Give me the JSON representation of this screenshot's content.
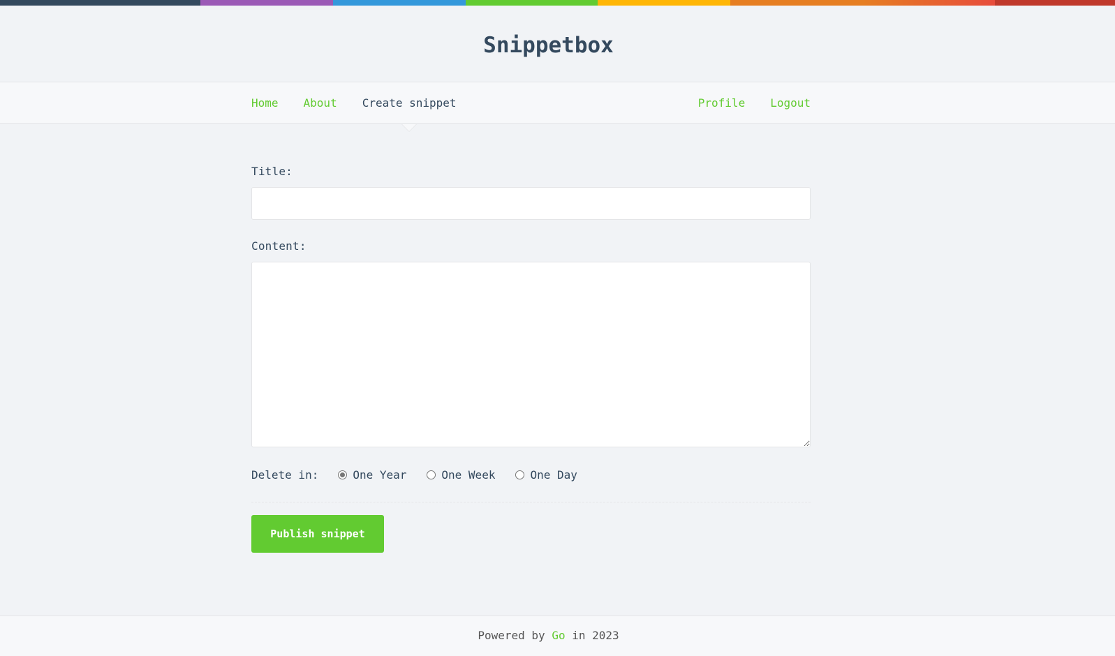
{
  "colors": {
    "accent": "#62cb31",
    "text": "#34495e",
    "rainbow": [
      "#34495e",
      "#9b59b6",
      "#3498db",
      "#62cb31",
      "#ffb606",
      "#e67e22",
      "#e74c3c",
      "#c0392b"
    ]
  },
  "header": {
    "title": "Snippetbox"
  },
  "nav": {
    "home": "Home",
    "about": "About",
    "create": "Create snippet",
    "profile": "Profile",
    "logout": "Logout"
  },
  "form": {
    "title_label": "Title:",
    "title_value": "",
    "content_label": "Content:",
    "content_value": "",
    "expires_label": "Delete in:",
    "expires_options": [
      {
        "label": "One Year",
        "checked": true
      },
      {
        "label": "One Week",
        "checked": false
      },
      {
        "label": "One Day",
        "checked": false
      }
    ],
    "submit_label": "Publish snippet"
  },
  "footer": {
    "prefix": "Powered by",
    "link": "Go",
    "suffix": "in 2023"
  }
}
